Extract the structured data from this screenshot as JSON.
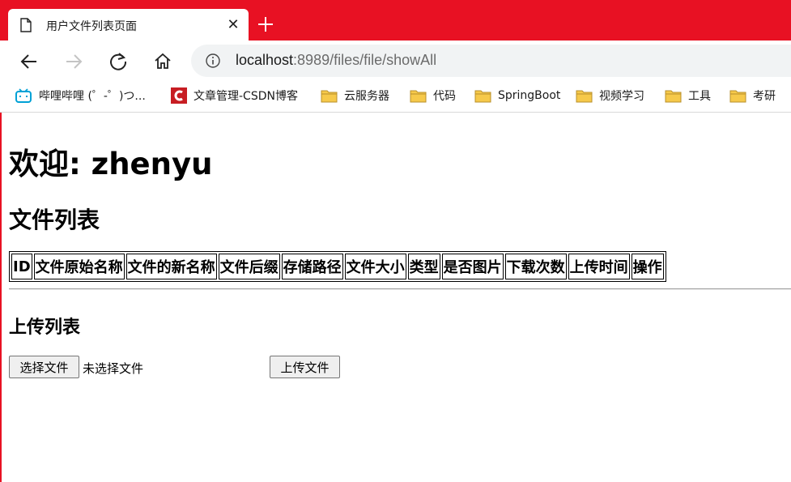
{
  "browser": {
    "tab": {
      "title": "用户文件列表页面"
    },
    "address": {
      "host": "localhost",
      "path": ":8989/files/file/showAll"
    },
    "bookmarks": [
      {
        "label": "哔哩哔哩 (゜-゜)つ...",
        "icon": "bilibili-icon"
      },
      {
        "label": "文章管理-CSDN博客",
        "icon": "csdn-icon"
      },
      {
        "label": "云服务器",
        "icon": "folder-icon"
      },
      {
        "label": "代码",
        "icon": "folder-icon"
      },
      {
        "label": "SpringBoot",
        "icon": "folder-icon"
      },
      {
        "label": "视频学习",
        "icon": "folder-icon"
      },
      {
        "label": "工具",
        "icon": "folder-icon"
      },
      {
        "label": "考研",
        "icon": "folder-icon"
      }
    ],
    "colors": {
      "accent": "#e81123",
      "folder": "#f6c94a",
      "bilibili": "#00a1d6",
      "csdn": "#c71d23"
    }
  },
  "page": {
    "welcome": "欢迎: zhenyu",
    "list_title": "文件列表",
    "table_headers": [
      "ID",
      "文件原始名称",
      "文件的新名称",
      "文件后缀",
      "存储路径",
      "文件大小",
      "类型",
      "是否图片",
      "下载次数",
      "上传时间",
      "操作"
    ],
    "upload_title": "上传列表",
    "choose_file_label": "选择文件",
    "no_file_label": "未选择文件",
    "upload_button_label": "上传文件"
  }
}
